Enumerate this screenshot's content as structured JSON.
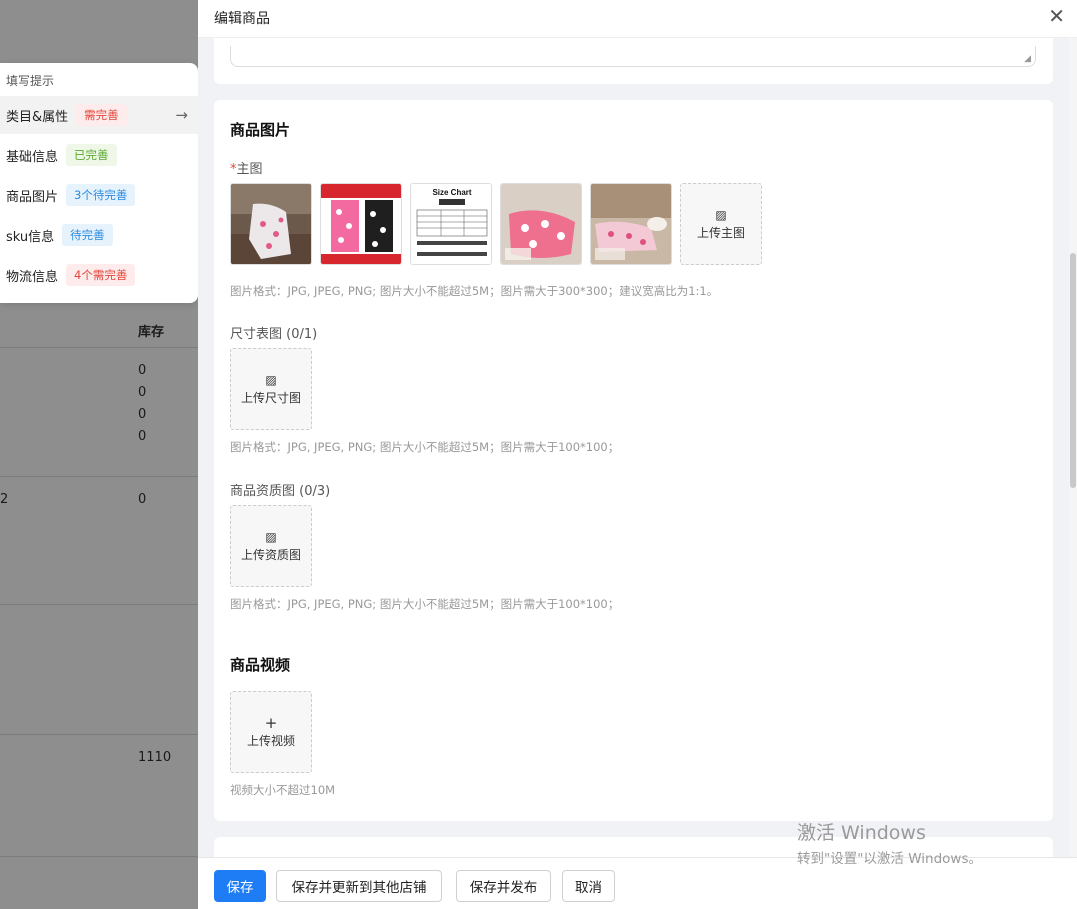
{
  "background": {
    "column_header": "库存",
    "values": [
      "0",
      "0",
      "0",
      "0",
      "0",
      "1110"
    ],
    "left_value": "2"
  },
  "tips": {
    "title": "填写提示",
    "items": [
      {
        "label": "类目&属性",
        "tag": "需完善"
      },
      {
        "label": "基础信息",
        "tag": "已完善"
      },
      {
        "label": "商品图片",
        "tag": "3个待完善"
      },
      {
        "label": "sku信息",
        "tag": "待完善"
      },
      {
        "label": "物流信息",
        "tag": "4个需完善"
      }
    ]
  },
  "drawer": {
    "title": "编辑商品",
    "close_icon": "close-icon"
  },
  "images_section": {
    "title": "商品图片",
    "main": {
      "label_required": "*",
      "label": "主图",
      "upload_label": "上传主图",
      "hint": "图片格式：JPG, JPEG, PNG; 图片大小不能超过5M；图片需大于300*300；建议宽高比为1:1。",
      "size_chart_thumb_title": "Size Chart"
    },
    "size_chart": {
      "label": "尺寸表图 (0/1)",
      "upload_label": "上传尺寸图",
      "hint": "图片格式：JPG, JPEG, PNG; 图片大小不能超过5M；图片需大于100*100；"
    },
    "qualification": {
      "label": "商品资质图 (0/3)",
      "upload_label": "上传资质图",
      "hint": "图片格式：JPG, JPEG, PNG; 图片大小不能超过5M；图片需大于100*100；"
    },
    "video": {
      "title": "商品视频",
      "upload_label": "上传视频",
      "hint": "视频大小不超过10M"
    }
  },
  "footer": {
    "save": "保存",
    "save_update": "保存并更新到其他店铺",
    "save_publish": "保存并发布",
    "cancel": "取消"
  },
  "watermark": {
    "line1": "激活 Windows",
    "line2": "转到\"设置\"以激活 Windows。"
  },
  "colors": {
    "primary": "#1e7df5",
    "required": "#e2473c",
    "tag_red": "#e2473c",
    "tag_green": "#5aaa2f",
    "tag_blue": "#2a8ae0"
  }
}
